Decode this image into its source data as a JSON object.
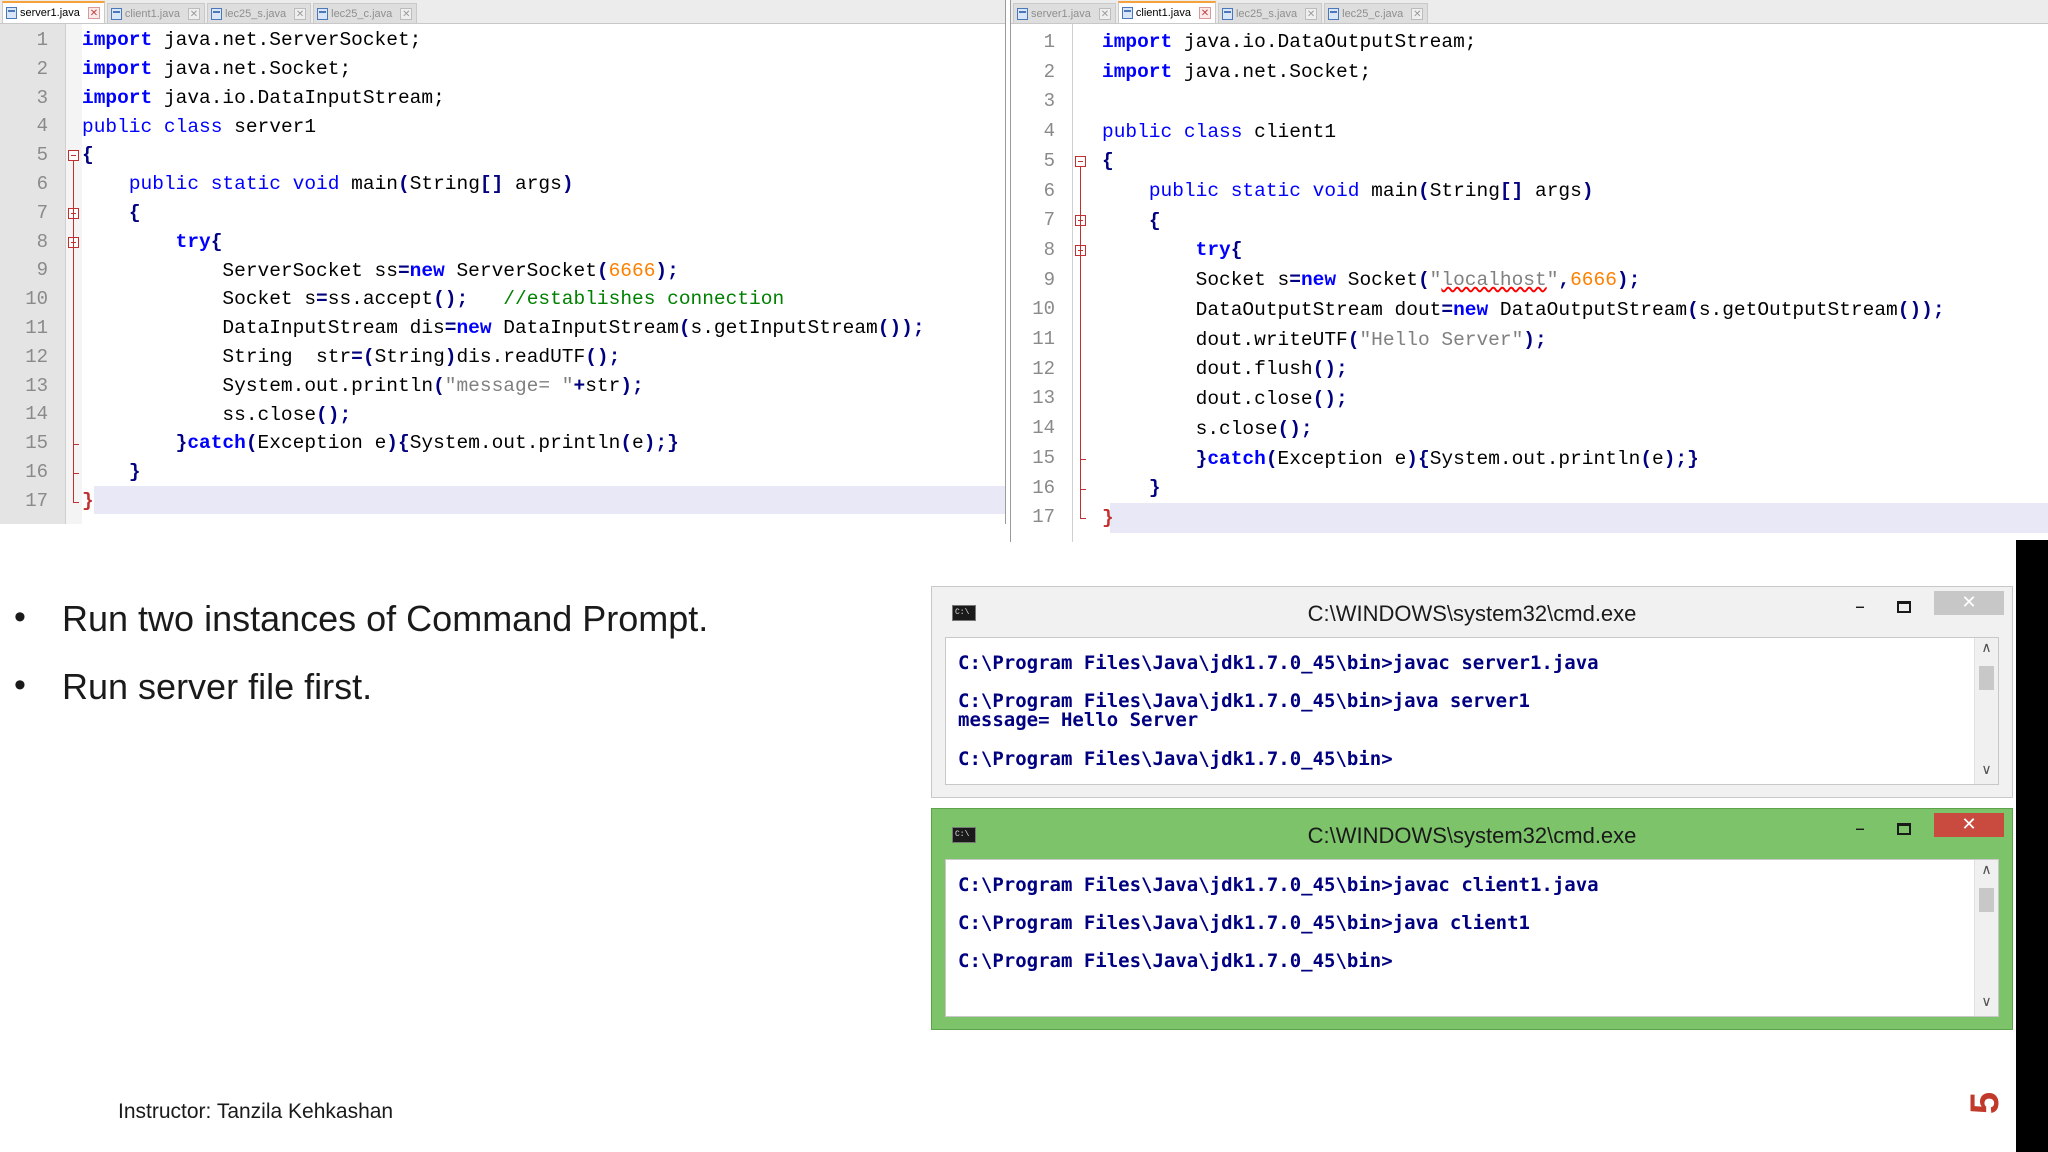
{
  "left_editor": {
    "tabs": [
      {
        "label": "server1.java",
        "active": true
      },
      {
        "label": "client1.java",
        "active": false
      },
      {
        "label": "lec25_s.java",
        "active": false
      },
      {
        "label": "lec25_c.java",
        "active": false
      }
    ],
    "line_numbers": [
      "1",
      "2",
      "3",
      "4",
      "5",
      "6",
      "7",
      "8",
      "9",
      "10",
      "11",
      "12",
      "13",
      "14",
      "15",
      "16",
      "17"
    ]
  },
  "right_editor": {
    "tabs": [
      {
        "label": "server1.java",
        "active": false
      },
      {
        "label": "client1.java",
        "active": true
      },
      {
        "label": "lec25_s.java",
        "active": false
      },
      {
        "label": "lec25_c.java",
        "active": false
      }
    ],
    "line_numbers": [
      "1",
      "2",
      "3",
      "4",
      "5",
      "6",
      "7",
      "8",
      "9",
      "10",
      "11",
      "12",
      "13",
      "14",
      "15",
      "16",
      "17"
    ]
  },
  "bullets": [
    "Run two instances of Command Prompt.",
    "Run server file first."
  ],
  "cmd_server": {
    "title": "C:\\WINDOWS\\system32\\cmd.exe",
    "lines": [
      "C:\\Program Files\\Java\\jdk1.7.0_45\\bin>javac server1.java",
      "C:\\Program Files\\Java\\jdk1.7.0_45\\bin>java server1",
      "message= Hello Server",
      "C:\\Program Files\\Java\\jdk1.7.0_45\\bin>"
    ]
  },
  "cmd_client": {
    "title": "C:\\WINDOWS\\system32\\cmd.exe",
    "lines": [
      "C:\\Program Files\\Java\\jdk1.7.0_45\\bin>javac client1.java",
      "C:\\Program Files\\Java\\jdk1.7.0_45\\bin>java client1",
      "C:\\Program Files\\Java\\jdk1.7.0_45\\bin>"
    ]
  },
  "window_controls": {
    "minimize": "–",
    "close": "✕",
    "scroll_up": "∧",
    "scroll_down": "∨",
    "cmd_icon": "C:\\"
  },
  "footer": {
    "instructor": "Instructor: Tanzila Kehkashan",
    "page_number": "5"
  },
  "colors": {
    "keyword": "#0000ff",
    "number": "#ff8000",
    "string": "#808080",
    "comment": "#008000",
    "cmd_text": "#000080",
    "active_cmd_frame": "#7cc36a"
  }
}
